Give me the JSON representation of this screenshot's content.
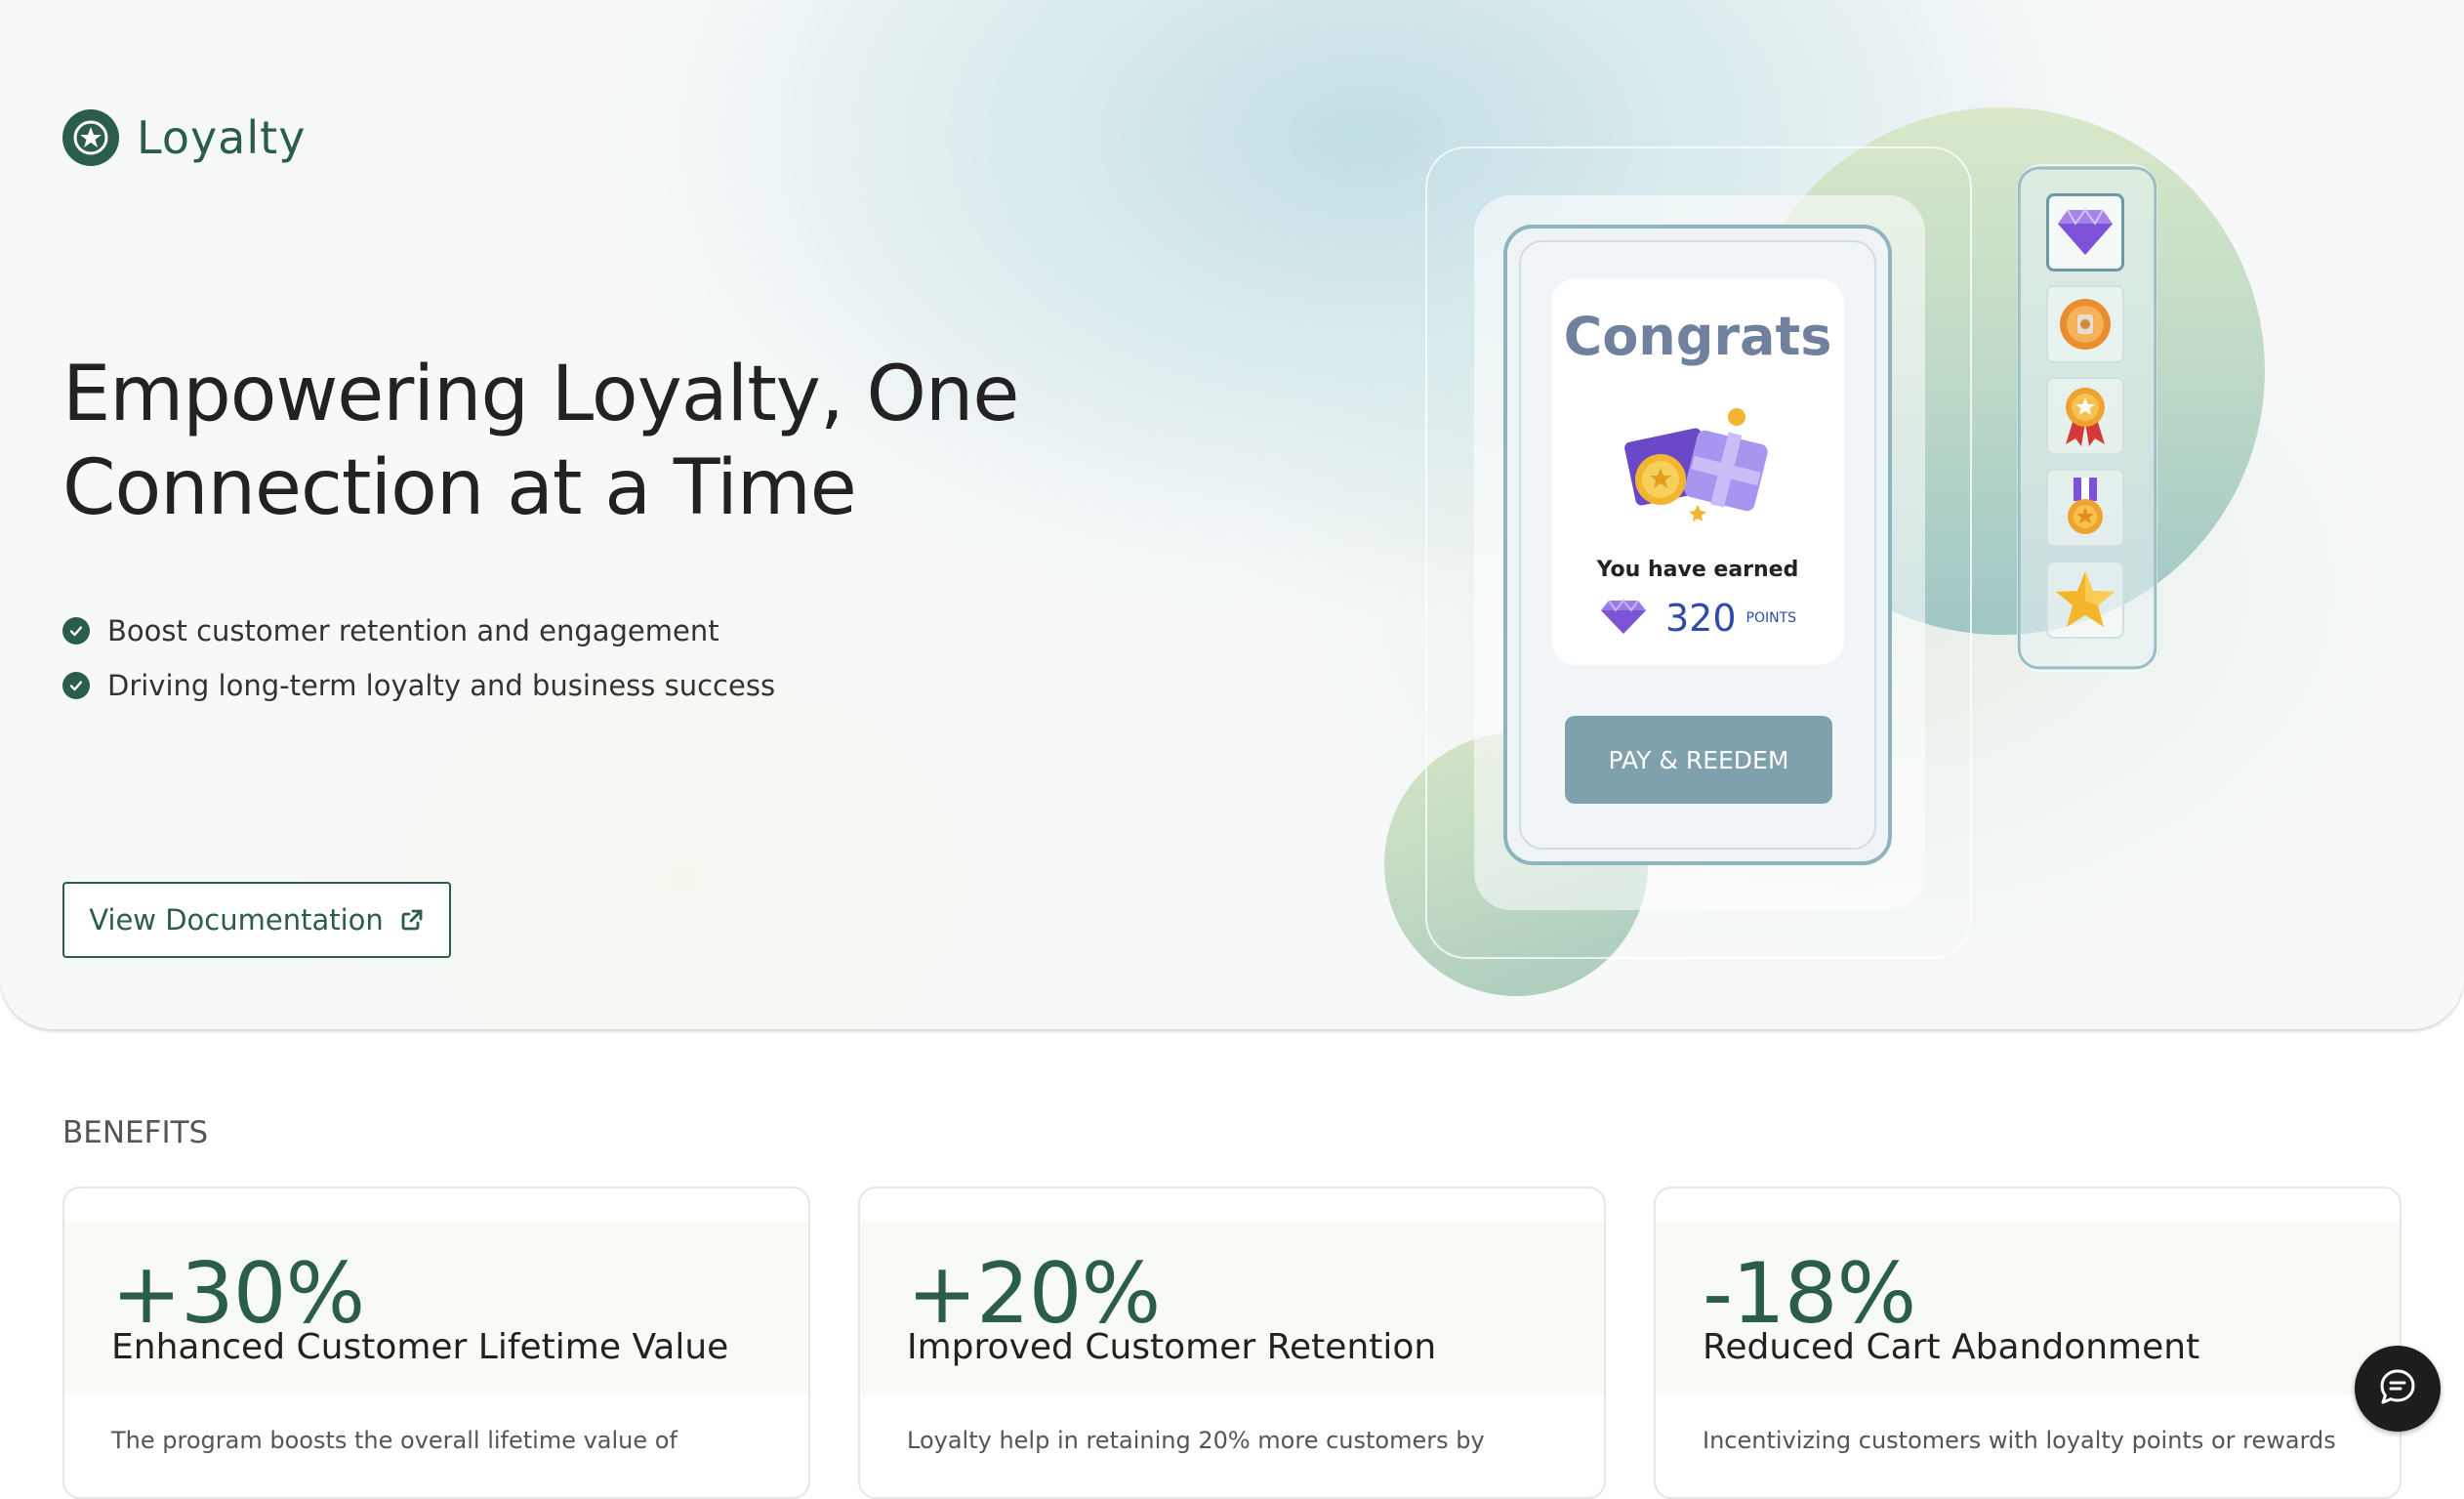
{
  "brand": {
    "name": "Loyalty",
    "icon": "star-badge-icon",
    "color": "#2b5d4b"
  },
  "hero": {
    "headline": "Empowering Loyalty, One Connection at a Time",
    "bullets": [
      "Boost customer retention and engagement",
      "Driving long-term loyalty and business success"
    ],
    "cta_label": "View Documentation",
    "cta_icon": "external-link-icon"
  },
  "illustration": {
    "congrats_title": "Congrats",
    "earned_text": "You have earned",
    "points_value": "320",
    "points_label": "POINTS",
    "redeem_label": "PAY & REEDEM",
    "badges": [
      "diamond-icon",
      "coin-icon",
      "medal-ribbon-icon",
      "medal-icon",
      "star-icon"
    ]
  },
  "benefits": {
    "heading": "BENEFITS",
    "cards": [
      {
        "stat": "+30%",
        "title": "Enhanced Customer Lifetime Value",
        "desc": "The program boosts the overall lifetime value of"
      },
      {
        "stat": "+20%",
        "title": "Improved Customer Retention",
        "desc": "Loyalty help in retaining 20% more customers by"
      },
      {
        "stat": "-18%",
        "title": "Reduced Cart Abandonment",
        "desc": "Incentivizing customers with loyalty points or rewards"
      }
    ]
  },
  "chat": {
    "icon": "chat-icon"
  }
}
